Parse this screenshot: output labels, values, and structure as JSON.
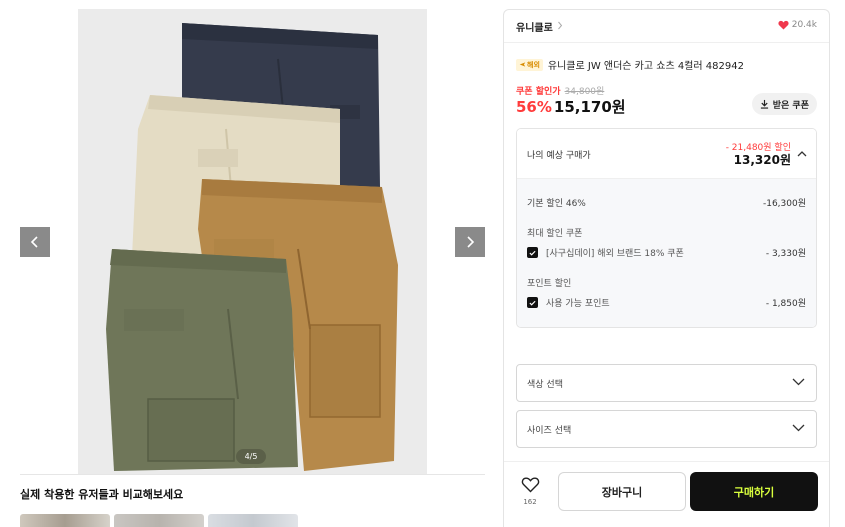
{
  "gallery": {
    "image_alt": "product-photo-four-cargo-shorts",
    "counter": "4/5",
    "prev_icon": "chevron-left-icon",
    "next_icon": "chevron-right-icon",
    "compare_title": "실제 착용한 유저들과 비교해보세요"
  },
  "brand": {
    "name": "유니클로",
    "likes": "20.4k"
  },
  "product": {
    "badge": "해외",
    "title": "유니클로 JW 앤더슨 카고 쇼츠 4컬러 482942",
    "coupon_price_label": "쿠폰 할인가",
    "original_price": "34,800원",
    "discount_rate": "56%",
    "sale_price": "15,170원",
    "coupon_button": "받은 쿠폰"
  },
  "estimate": {
    "label": "나의 예상 구매가",
    "total_discount": "- 21,480원 할인",
    "price": "13,320원",
    "base_discount_label": "기본 할인 46%",
    "base_discount_value": "-16,300원",
    "coupon_group_label": "최대 할인 쿠폰",
    "coupon_item_label": "[사구십데이] 해외 브랜드 18% 쿠폰",
    "coupon_item_value": "- 3,330원",
    "point_group_label": "포인트 할인",
    "point_item_label": "사용 가능 포인트",
    "point_item_value": "- 1,850원"
  },
  "options": {
    "color_placeholder": "색상 선택",
    "size_placeholder": "사이즈 선택"
  },
  "actions": {
    "wish_count": "162",
    "cart_label": "장바구니",
    "buy_label": "구매하기"
  },
  "colors": {
    "accent_red": "#ff3b3b",
    "buy_text": "#d9ff3d",
    "buy_bg": "#111111"
  }
}
